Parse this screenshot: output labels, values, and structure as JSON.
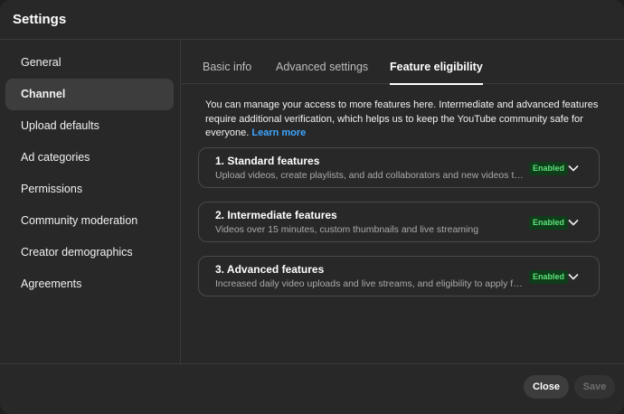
{
  "dialog": {
    "title": "Settings"
  },
  "sidebar": {
    "items": [
      {
        "label": "General"
      },
      {
        "label": "Channel"
      },
      {
        "label": "Upload defaults"
      },
      {
        "label": "Ad categories"
      },
      {
        "label": "Permissions"
      },
      {
        "label": "Community moderation"
      },
      {
        "label": "Creator demographics"
      },
      {
        "label": "Agreements"
      }
    ],
    "active": "Channel"
  },
  "tabs": [
    {
      "label": "Basic info"
    },
    {
      "label": "Advanced settings"
    },
    {
      "label": "Feature eligibility"
    }
  ],
  "active_tab": "Feature eligibility",
  "intro": {
    "text": "You can manage your access to more features here. Intermediate and advanced features require additional verification, which helps us to keep the YouTube community safe for everyone.",
    "link": "Learn more"
  },
  "features": [
    {
      "title": "1. Standard features",
      "desc": "Upload videos, create playlists, and add collaborators and new videos to playlists",
      "status": "Enabled"
    },
    {
      "title": "2. Intermediate features",
      "desc": "Videos over 15 minutes, custom thumbnails and live streaming",
      "status": "Enabled"
    },
    {
      "title": "3. Advanced features",
      "desc": "Increased daily video uploads and live streams, and eligibility to apply for YouTube features",
      "status": "Enabled"
    }
  ],
  "footer": {
    "close": "Close",
    "save": "Save"
  },
  "colors": {
    "link": "#3ea6ff",
    "badge_text": "#5ee37b",
    "badge_bg": "#0f3d1a"
  }
}
